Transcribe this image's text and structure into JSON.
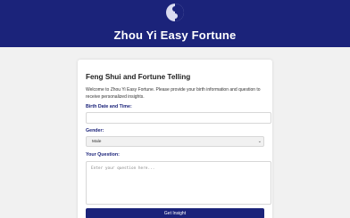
{
  "header": {
    "title": "Zhou Yi Easy Fortune",
    "logo_icon": "yin-yang-icon"
  },
  "form": {
    "heading": "Feng Shui and Fortune Telling",
    "intro": "Welcome to Zhou Yi Easy Fortune. Please provide your birth information and question to receive personalized insights.",
    "birth_label": "Birth Date and Time:",
    "birth_value": "",
    "gender_label": "Gender:",
    "gender_value": "Male",
    "question_label": "Your Question:",
    "question_placeholder": "Enter your question here...",
    "submit_label": "Get Insight"
  },
  "colors": {
    "brand": "#1b237a",
    "background": "#f1f1f1",
    "card": "#ffffff"
  }
}
